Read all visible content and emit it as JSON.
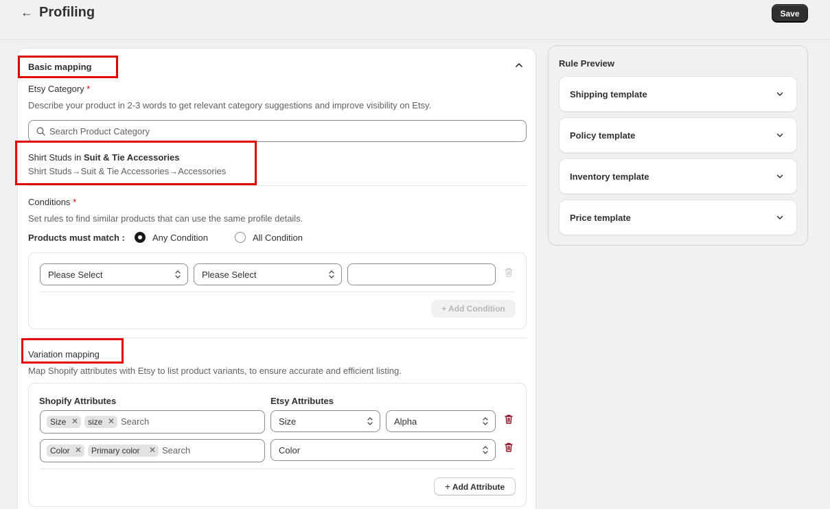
{
  "header": {
    "back_icon": "arrow-left-icon",
    "title": "Profiling",
    "save_label": "Save"
  },
  "basic_mapping": {
    "title": "Basic mapping",
    "category_label": "Etsy Category",
    "required_mark": "*",
    "category_help": "Describe your product in 2-3 words to get relevant category suggestions and improve visibility on Etsy.",
    "search_placeholder": "Search Product Category",
    "selected_category": {
      "name": "Shirt Studs",
      "in_word": "in",
      "parent": "Suit & Tie Accessories",
      "path": "Shirt Studs→Suit & Tie Accessories→Accessories"
    },
    "conditions_label": "Conditions",
    "conditions_help": "Set rules to find similar products that can use the same profile details.",
    "match_label": "Products must match :",
    "match_options": [
      "Any Condition",
      "All Condition"
    ],
    "match_selected": "Any Condition",
    "condition_row": {
      "field_value": "Please Select",
      "operator_value": "Please Select",
      "text_value": ""
    },
    "add_condition_label": "Add Condition"
  },
  "variation_mapping": {
    "title": "Variation mapping",
    "help": "Map Shopify attributes with Etsy to list product variants, to ensure accurate and efficient listing.",
    "shopify_header": "Shopify Attributes",
    "etsy_header": "Etsy Attributes",
    "rows": [
      {
        "tags": [
          "Size",
          "size"
        ],
        "search_placeholder": "Search",
        "etsy_attribute": "Size",
        "etsy_value": "Alpha"
      },
      {
        "tags": [
          "Color",
          "Primary color"
        ],
        "search_placeholder": "Search",
        "etsy_attribute": "Color"
      }
    ],
    "add_attribute_label": "Add Attribute"
  },
  "rule_preview": {
    "title": "Rule Preview",
    "templates": [
      "Shipping template",
      "Policy template",
      "Inventory template",
      "Price template"
    ]
  },
  "colors": {
    "highlight_box": "#e00000",
    "danger": "#8e0b21",
    "primary_button": "#303030",
    "required": "#c70000"
  }
}
